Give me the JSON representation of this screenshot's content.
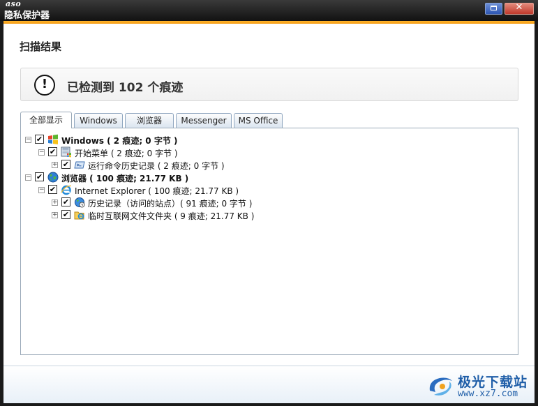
{
  "window": {
    "brand": "aso",
    "title": "隐私保护器",
    "close_glyph": "✕"
  },
  "content": {
    "section_title": "扫描结果",
    "alert": {
      "icon": "exclamation-circle-icon",
      "glyph": "!",
      "text": "已检测到 102 个痕迹"
    },
    "tabs": [
      {
        "label": "全部显示",
        "active": true
      },
      {
        "label": "Windows",
        "active": false
      },
      {
        "label": "浏览器",
        "active": false
      },
      {
        "label": "Messenger",
        "active": false
      },
      {
        "label": "MS Office",
        "active": false
      }
    ],
    "tree": [
      {
        "label": "Windows ( 2 痕迹; 0 字节 )",
        "level": 0,
        "expanded": true,
        "checked": true,
        "icon": "windows-logo-icon",
        "bold": true
      },
      {
        "label": "开始菜单 ( 2 痕迹; 0 字节 )",
        "level": 1,
        "expanded": true,
        "checked": true,
        "icon": "start-menu-icon",
        "bold": false
      },
      {
        "label": "运行命令历史记录 ( 2 痕迹; 0 字节 )",
        "level": 2,
        "expanded": false,
        "checked": true,
        "icon": "run-command-icon",
        "bold": false
      },
      {
        "label": "浏览器 ( 100 痕迹; 21.77 KB )",
        "level": 0,
        "expanded": true,
        "checked": true,
        "icon": "globe-icon",
        "bold": true
      },
      {
        "label": "Internet Explorer ( 100 痕迹; 21.77 KB )",
        "level": 1,
        "expanded": true,
        "checked": true,
        "icon": "internet-explorer-icon",
        "bold": false
      },
      {
        "label": "历史记录（访问的站点）( 91 痕迹; 0 字节 )",
        "level": 2,
        "expanded": false,
        "checked": true,
        "icon": "history-globe-icon",
        "bold": false
      },
      {
        "label": "临时互联网文件文件夹 ( 9 痕迹; 21.77 KB )",
        "level": 2,
        "expanded": false,
        "checked": true,
        "icon": "temp-files-folder-icon",
        "bold": false
      }
    ],
    "expander_expanded": "−",
    "expander_collapsed": "+",
    "checkmark": "✔"
  },
  "watermark": {
    "text": "极光下载站",
    "url": "www.xz7.com"
  },
  "colors": {
    "accent_orange": "#f5a623",
    "title_bar": "#1a1a1a",
    "watermark_blue": "#1f5ea8"
  }
}
